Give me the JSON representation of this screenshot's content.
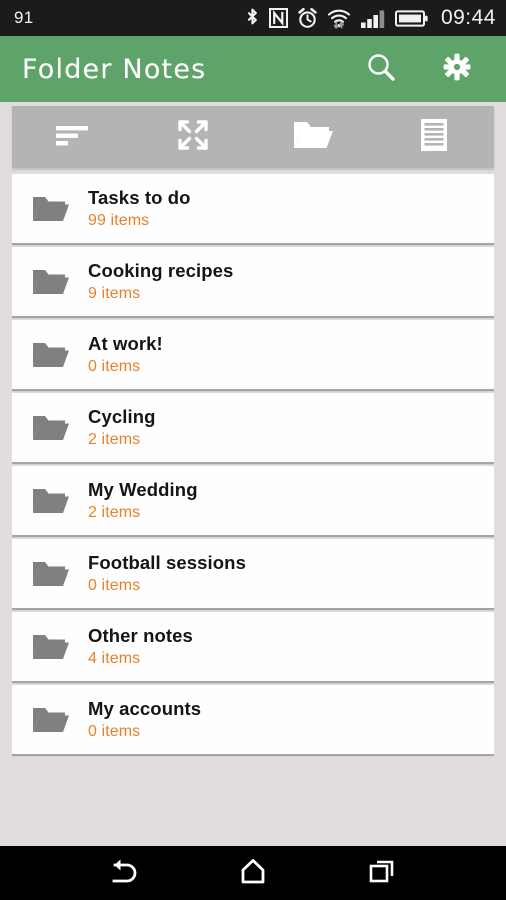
{
  "status_bar": {
    "left_text": "91",
    "time": "09:44",
    "icons": [
      "bluetooth-icon",
      "nfc-icon",
      "alarm-icon",
      "wifi-icon",
      "signal-icon",
      "battery-icon"
    ],
    "signal_bars_filled": 3,
    "signal_bars_total": 4,
    "background_color": "#1B1B1B",
    "foreground_color": "#F2F2F2"
  },
  "app_bar": {
    "title": "Folder Notes",
    "background_color": "#5EA369",
    "actions": [
      {
        "name": "search-button",
        "icon": "search-icon"
      },
      {
        "name": "settings-button",
        "icon": "gear-icon"
      }
    ]
  },
  "toolbar": {
    "background_color": "#B4B4B4",
    "buttons": [
      {
        "name": "sort-button",
        "icon": "sort-lines-icon"
      },
      {
        "name": "expand-all-button",
        "icon": "expand-arrows-icon"
      },
      {
        "name": "new-folder-button",
        "icon": "open-folder-icon"
      },
      {
        "name": "new-note-button",
        "icon": "document-lines-icon"
      }
    ]
  },
  "list": {
    "accent_color": "#E8822A",
    "folder_icon_color": "#808080",
    "items": [
      {
        "title": "Tasks to do",
        "count": "99 items"
      },
      {
        "title": "Cooking recipes",
        "count": "9 items"
      },
      {
        "title": "At work!",
        "count": "0 items"
      },
      {
        "title": "Cycling",
        "count": "2 items"
      },
      {
        "title": "My Wedding",
        "count": "2 items"
      },
      {
        "title": "Football sessions",
        "count": "0 items"
      },
      {
        "title": "Other notes",
        "count": "4 items"
      },
      {
        "title": "My accounts",
        "count": "0 items"
      }
    ]
  },
  "nav_bar": {
    "background_color": "#000000",
    "buttons": [
      {
        "name": "back-button",
        "icon": "back-arrow-icon"
      },
      {
        "name": "home-button",
        "icon": "home-icon"
      },
      {
        "name": "recents-button",
        "icon": "recents-squares-icon"
      }
    ]
  }
}
